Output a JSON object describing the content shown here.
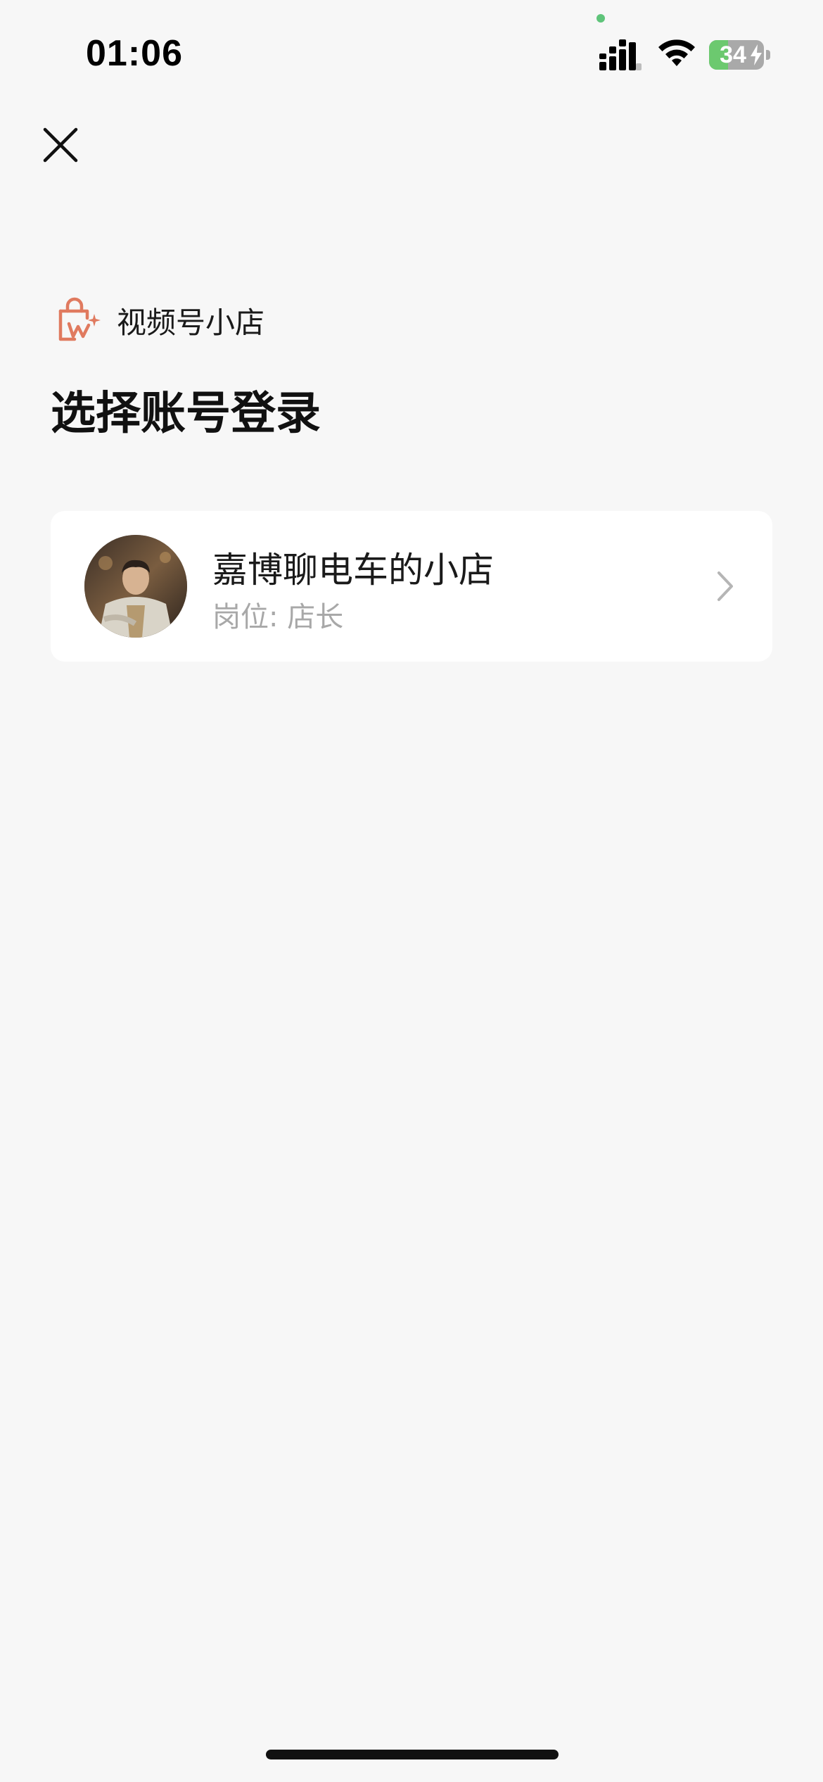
{
  "status_bar": {
    "time": "01:06",
    "battery_level": "34",
    "battery_fraction": 0.34,
    "charging": true,
    "signal_icon": "cellular-signal-icon",
    "wifi_icon": "wifi-icon"
  },
  "header": {
    "close_icon": "close-icon"
  },
  "brand": {
    "icon": "shopping-bag-sparkle-icon",
    "name": "视频号小店",
    "accent_color": "#e07a5f"
  },
  "page": {
    "title": "选择账号登录"
  },
  "accounts": [
    {
      "name": "嘉博聊电车的小店",
      "role": "岗位: 店长",
      "avatar": "avatar-photo",
      "chevron": "chevron-right-icon"
    }
  ]
}
